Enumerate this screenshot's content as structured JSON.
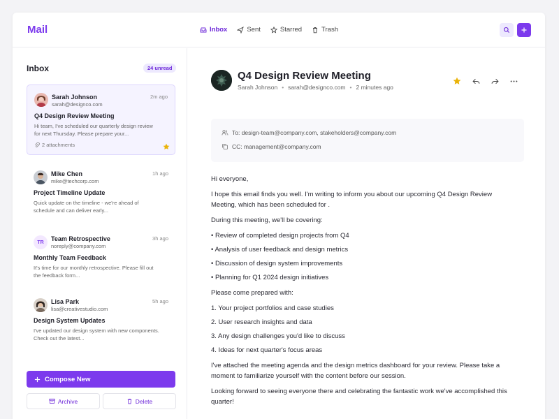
{
  "app": {
    "title": "Mail"
  },
  "nav": [
    {
      "label": "Inbox",
      "active": true
    },
    {
      "label": "Sent"
    },
    {
      "label": "Starred"
    },
    {
      "label": "Trash"
    }
  ],
  "sidebar": {
    "title": "Inbox",
    "unread": "24 unread",
    "compose": "Compose New",
    "archive": "Archive",
    "delete": "Delete"
  },
  "mails": [
    {
      "name": "Sarah Johnson",
      "email": "sarah@designco.com",
      "time": "2m ago",
      "subject": "Q4 Design Review Meeting",
      "preview": "Hi team, I've scheduled our quarterly design review for next Thursday. Please prepare your...",
      "attachments": "2 attachments",
      "starred": true,
      "selected": true
    },
    {
      "name": "Mike Chen",
      "email": "mike@techcorp.com",
      "time": "1h ago",
      "subject": "Project Timeline Update",
      "preview": "Quick update on the timeline - we're ahead of schedule and can deliver early..."
    },
    {
      "name": "Team Retrospective",
      "initials": "TR",
      "email": "noreply@company.com",
      "time": "3h ago",
      "subject": "Monthly Team Feedback",
      "preview": "It's time for our monthly retrospective. Please fill out the feedback form..."
    },
    {
      "name": "Lisa Park",
      "email": "lisa@creativestudio.com",
      "time": "5h ago",
      "subject": "Design System Updates",
      "preview": "I've updated our design system with new components. Check out the latest..."
    }
  ],
  "message": {
    "subject": "Q4 Design Review Meeting",
    "sender": "Sarah Johnson",
    "email": "sarah@designco.com",
    "time": "2 minutes ago",
    "to": "To: design-team@company.com, stakeholders@company.com",
    "cc": "CC: management@company.com",
    "greeting": "Hi everyone,",
    "p1": "I hope this email finds you well. I'm writing to inform you about our upcoming Q4 Design Review Meeting, which has been scheduled for .",
    "p2": "During this meeting, we'll be covering:",
    "bullets": [
      "• Review of completed design projects from Q4",
      "• Analysis of user feedback and design metrics",
      "• Discussion of design system improvements",
      "• Planning for Q1 2024 design initiatives"
    ],
    "p3": "Please come prepared with:",
    "numbered": [
      "1. Your project portfolios and case studies",
      "2. User research insights and data",
      "3. Any design challenges you'd like to discuss",
      "4. Ideas for next quarter's focus areas"
    ],
    "p4": "I've attached the meeting agenda and the design metrics dashboard for your review. Please take a moment to familiarize yourself with the content before our session.",
    "p5": "Looking forward to seeing everyone there and celebrating the fantastic work we've accomplished this quarter!"
  },
  "colors": {
    "accent": "#7c3aed",
    "star": "#facc15"
  }
}
